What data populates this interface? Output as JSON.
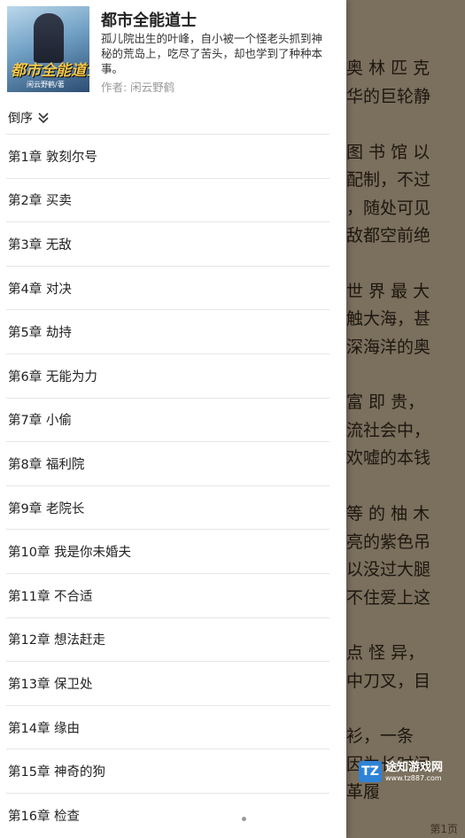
{
  "book": {
    "title": "都市全能道士",
    "description": "孤儿院出生的叶峰，自小被一个怪老头抓到神秘的荒岛上，吃尽了苦头，却也学到了种种本事。",
    "author": "作者: 闲云野鹤",
    "cover_title": "都市全能道士",
    "cover_author": "闲云野鹤/著"
  },
  "sort": {
    "label": "倒序"
  },
  "chapters": [
    "第1章 敦刻尔号",
    "第2章 买卖",
    "第3章 无敌",
    "第4章 对决",
    "第5章 劫持",
    "第6章 无能为力",
    "第7章 小偷",
    "第8章 福利院",
    "第9章 老院长",
    "第10章 我是你未婚夫",
    "第11章 不合适",
    "第12章 想法赶走",
    "第13章 保卫处",
    "第14章 缘由",
    "第15章 神奇的狗",
    "第16章 检查"
  ],
  "reader": {
    "lines": [
      {
        "text": "奥 林 匹 克"
      },
      {
        "text": "华的巨轮静"
      },
      {
        "text": "图 书 馆 以"
      },
      {
        "text": "配制，不过"
      },
      {
        "text": "，随处可见"
      },
      {
        "text": "敌都空前绝"
      },
      {
        "text": "世 界 最 大"
      },
      {
        "text": "触大海，甚"
      },
      {
        "text": "深海洋的奥"
      },
      {
        "text": "富 即 贵，"
      },
      {
        "text": "流社会中，"
      },
      {
        "text": "欢嘘的本钱"
      },
      {
        "text": "等 的 柚 木"
      },
      {
        "text": "亮的紫色吊"
      },
      {
        "text": "以没过大腿"
      },
      {
        "text": "不住爱上这"
      },
      {
        "text": "点 怪 异，"
      },
      {
        "text": "中刀叉，目"
      },
      {
        "text": "衫，一条"
      },
      {
        "text": "因为长时间"
      },
      {
        "text": "革履"
      }
    ],
    "page_indicator": "第1页"
  },
  "watermark": {
    "logo": "TZ",
    "name": "途知游戏网",
    "url": "www.tz887.com"
  }
}
